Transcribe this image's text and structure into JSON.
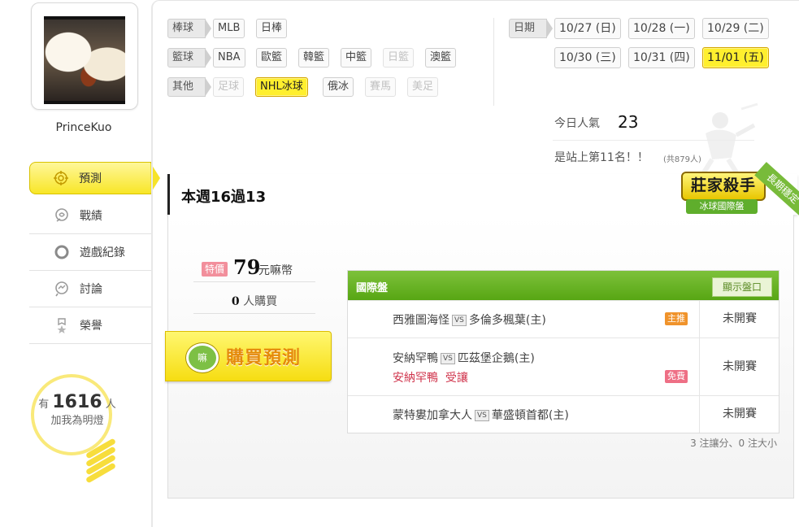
{
  "user": {
    "name": "PrinceKuo"
  },
  "nav": [
    {
      "label": "預測",
      "icon": "target-icon",
      "active": true
    },
    {
      "label": "戰績",
      "icon": "record-icon"
    },
    {
      "label": "遊戲紀錄",
      "icon": "circle-icon"
    },
    {
      "label": "討論",
      "icon": "chat-icon"
    },
    {
      "label": "榮譽",
      "icon": "medal-icon"
    }
  ],
  "fans": {
    "prefix": "有",
    "count": "1616",
    "suffix": "人",
    "caption": "加我為明燈"
  },
  "filters": {
    "baseball": {
      "label": "棒球",
      "items": [
        "MLB",
        "日棒"
      ]
    },
    "basketball": {
      "label": "籃球",
      "items": [
        "NBA",
        "歐籃",
        "韓籃",
        "中籃",
        "日籃",
        "澳籃"
      ]
    },
    "other": {
      "label": "其他",
      "items": [
        "足球",
        "NHL冰球",
        "俄冰",
        "賽馬",
        "美足"
      ]
    }
  },
  "dates": {
    "label": "日期",
    "items": [
      "10/27 (日)",
      "10/28 (一)",
      "10/29 (二)",
      "10/30 (三)",
      "10/31 (四)",
      "11/01 (五)"
    ],
    "selected": "11/01 (五)"
  },
  "popularity": {
    "label": "今日人氣",
    "value": "23",
    "rank_text": "是站上第11名！！",
    "rank_total": "(共879人)"
  },
  "week": {
    "title": "本週16過13"
  },
  "badge": {
    "main": "莊家殺手",
    "sub": "冰球國際盤",
    "ribbon": "長期穩定"
  },
  "purchase": {
    "tag": "特價",
    "price": "79",
    "unit": "元嘛幣",
    "buyer_count": "0",
    "buyer_suffix": "人購買",
    "button_label": "購買預測",
    "button_icon_text": "嘛"
  },
  "games": {
    "header": "國際盤",
    "show_odds_label": "顯示盤口",
    "rows": [
      {
        "away": "西雅圖海怪",
        "vs": "VS",
        "home": "多倫多楓葉(主)",
        "tag": "主推",
        "status": "未開賽"
      },
      {
        "away": "安納罕鴨",
        "vs": "VS",
        "home": "匹茲堡企鵝(主)",
        "pick_team": "安納罕鴨",
        "pick_type": "受讓",
        "tag": "免費",
        "status": "未開賽"
      },
      {
        "away": "蒙特婁加拿大人",
        "vs": "VS",
        "home": "華盛頓首都(主)",
        "status": "未開賽"
      }
    ],
    "summary": "3 注讓分、0 注大小"
  },
  "colors": {
    "accent_yellow": "#ffef2e",
    "green_header": "#57a613",
    "tag_main": "#f0932b",
    "tag_free": "#ee6f85",
    "pick_red": "#d0344c"
  }
}
